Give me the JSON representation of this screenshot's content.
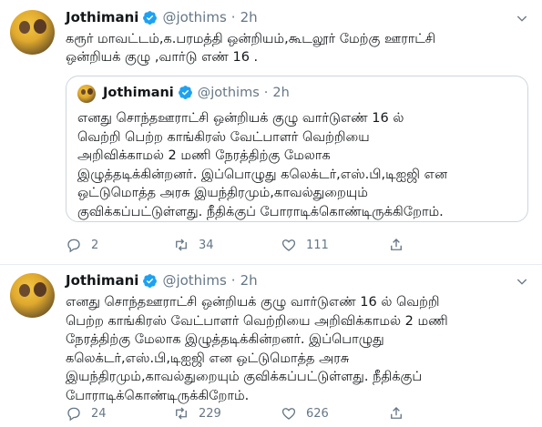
{
  "tweets": [
    {
      "name": "Jothimani",
      "handle": "@jothims",
      "sep": "·",
      "time": "2h",
      "lines": [
        "கரூர் மாவட்டம்,க.பரமத்தி ஒன்றியம்,கூடலூர் மேற்கு ஊராட்சி",
        "ஒன்றியக் குழு ,வார்டு எண் 16 ."
      ],
      "quoted": {
        "name": "Jothimani",
        "handle": "@jothims",
        "sep": "·",
        "time": "2h",
        "lines": [
          "எனது சொந்தஊராட்சி ஒன்றியக் குழு வார்டுஎண் 16 ல்",
          "வெற்றி பெற்ற காங்கிரஸ் வேட்பாளர் வெற்றியை",
          "அறிவிக்காமல் 2 மணி நேரத்திற்கு மேலாக",
          "இழுத்தடிக்கின்றனர். இப்பொழுது கலெக்டர்,எஸ்.பி,டிஐஜி என",
          "ஒட்டுமொத்த அரசு இயந்திரமும்,காவல்துறையும்",
          "குவிக்கப்பட்டுள்ளது. நீதிக்குப் போராடிக்கொண்டிருக்கிறோம்."
        ]
      },
      "replies": "2",
      "retweets": "34",
      "likes": "111"
    },
    {
      "name": "Jothimani",
      "handle": "@jothims",
      "sep": "·",
      "time": "2h",
      "lines": [
        "எனது சொந்தஊராட்சி ஒன்றியக் குழு வார்டுஎண் 16 ல் வெற்றி",
        "பெற்ற காங்கிரஸ் வேட்பாளர் வெற்றியை அறிவிக்காமல் 2 மணி",
        "நேரத்திற்கு மேலாக இழுத்தடிக்கின்றனர். இப்பொழுது",
        "கலெக்டர்,எஸ்.பி,டிஐஜி என ஒட்டுமொத்த அரசு",
        "இயந்திரமும்,காவல்துறையும் குவிக்கப்பட்டுள்ளது. நீதிக்குப்",
        "போராடிக்கொண்டிருக்கிறோம்."
      ],
      "replies": "24",
      "retweets": "229",
      "likes": "626"
    }
  ],
  "icons": {
    "verified": "verified-badge-icon",
    "caret": "chevron-down-icon",
    "reply": "reply-icon",
    "retweet": "retweet-icon",
    "like": "heart-icon",
    "share": "share-icon"
  },
  "colors": {
    "verified": "#1da1f2",
    "muted": "#657786",
    "text": "#14171a",
    "border": "#ccd6dd"
  }
}
